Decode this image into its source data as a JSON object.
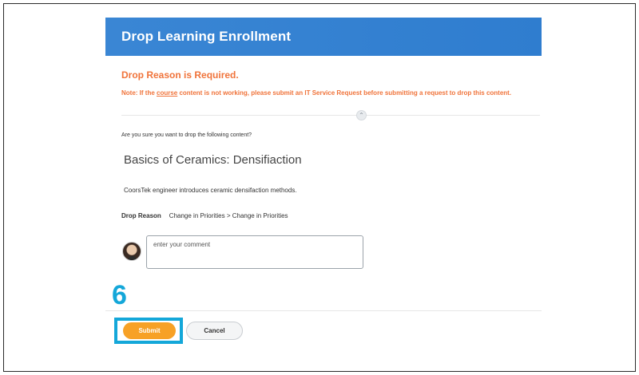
{
  "header": {
    "title": "Drop Learning Enrollment"
  },
  "errors": {
    "title": "Drop Reason is Required.",
    "note_prefix": "Note: If the ",
    "note_underlined": "course",
    "note_suffix": " content is not working, please submit an IT Service Request before submitting a request to drop this content."
  },
  "collapse_icon": "chevron-up-icon",
  "question": "Are you sure you want to drop the following content?",
  "course": {
    "title": "Basics of Ceramics: Densifiaction",
    "description": "CoorsTek engineer introduces ceramic densifaction methods."
  },
  "drop_reason": {
    "label": "Drop Reason",
    "value": "Change in Priorities > Change in Priorities"
  },
  "comment": {
    "placeholder": "enter your comment",
    "value": ""
  },
  "annotation": {
    "step_number": "6",
    "color": "#14a7d9"
  },
  "buttons": {
    "submit": "Submit",
    "cancel": "Cancel"
  },
  "colors": {
    "header": "#2f7dcf",
    "error": "#f0733a",
    "submit": "#f7a126"
  }
}
